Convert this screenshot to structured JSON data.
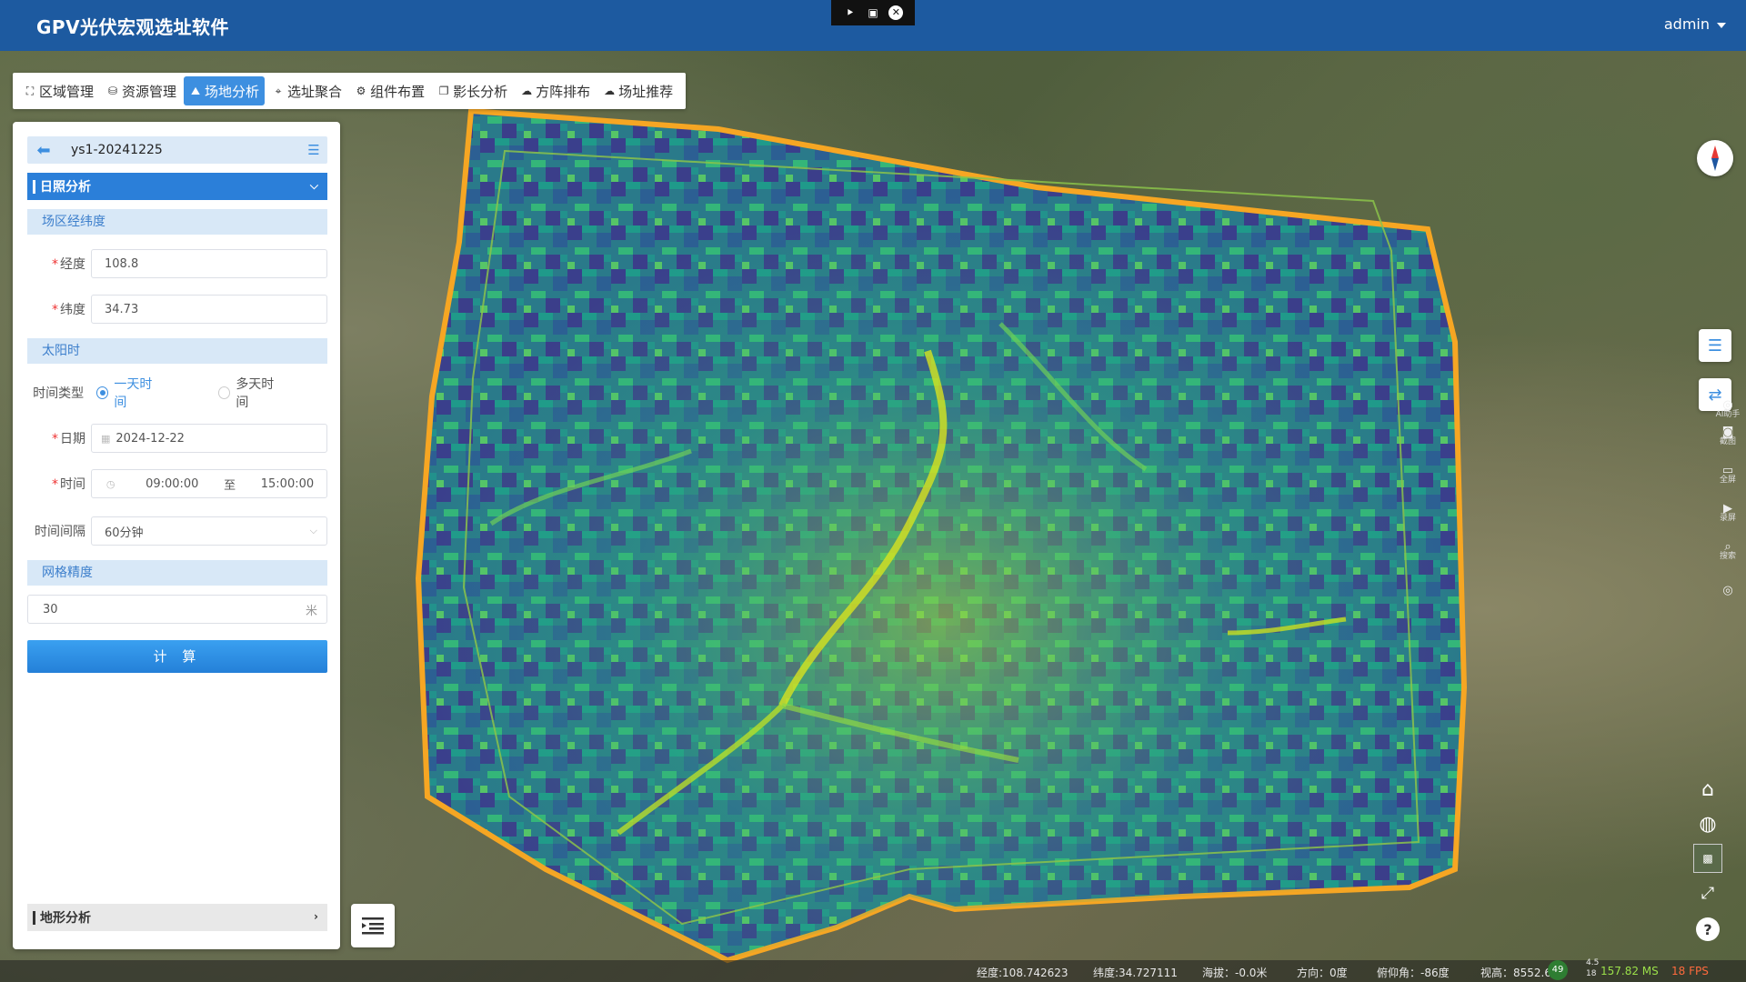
{
  "header": {
    "title": "GPV光伏宏观选址软件",
    "user": "admin"
  },
  "toolbar": {
    "items": [
      {
        "label": "区域管理",
        "icon": "map-frame-icon"
      },
      {
        "label": "资源管理",
        "icon": "database-icon"
      },
      {
        "label": "场地分析",
        "icon": "site-analysis-icon",
        "active": true
      },
      {
        "label": "选址聚合",
        "icon": "location-pin-icon"
      },
      {
        "label": "组件布置",
        "icon": "component-layout-icon"
      },
      {
        "label": "影长分析",
        "icon": "shadow-icon"
      },
      {
        "label": "方阵排布",
        "icon": "array-icon"
      },
      {
        "label": "场址推荐",
        "icon": "recommend-icon"
      }
    ]
  },
  "panel": {
    "project": "ys1-20241225",
    "section_sun": "日照分析",
    "sub_coord": "场区经纬度",
    "lon_label": "经度",
    "lon_value": "108.8",
    "lat_label": "纬度",
    "lat_value": "34.73",
    "sub_sun": "太阳时",
    "time_type_label": "时间类型",
    "time_type_one": "一天时间",
    "time_type_multi": "多天时间",
    "date_label": "日期",
    "date_value": "2024-12-22",
    "time_label": "时间",
    "time_start": "09:00:00",
    "time_sep": "至",
    "time_end": "15:00:00",
    "interval_label": "时间间隔",
    "interval_value": "60分钟",
    "sub_grid": "网格精度",
    "grid_value": "30",
    "grid_unit": "米",
    "calc_label": "计 算",
    "section_terrain": "地形分析"
  },
  "right_tools": [
    {
      "label": "AI助手"
    },
    {
      "label": "截图"
    },
    {
      "label": "全屏"
    },
    {
      "label": "录屏"
    },
    {
      "label": "搜索"
    }
  ],
  "status": {
    "lon": "经度:108.742623",
    "lat": "纬度:34.727111",
    "alt": "海拔：-0.0米",
    "heading": "方向：0度",
    "pitch": "俯仰角：-86度",
    "height": "视高：8552.6米",
    "net_count": "49",
    "net_top": "4.5",
    "net_bottom": "18",
    "ms": "157.82 MS",
    "fps": "18 FPS"
  },
  "colors": {
    "header": "#1d5aa0",
    "accent": "#2b7fd9",
    "boundary": "#f5a623"
  }
}
